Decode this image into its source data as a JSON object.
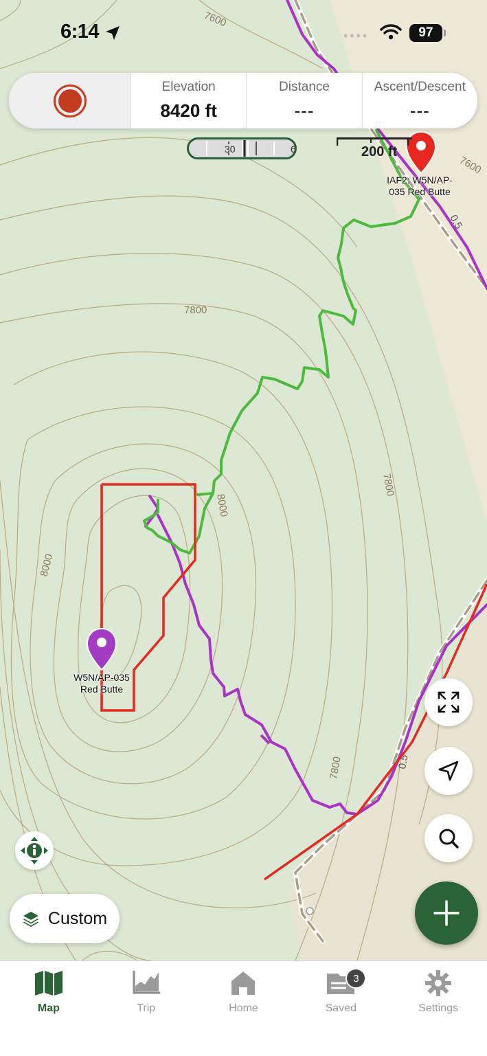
{
  "status_bar": {
    "time": "6:14",
    "battery": "97"
  },
  "stats": {
    "elevation": {
      "label": "Elevation",
      "value": "8420 ft"
    },
    "distance": {
      "label": "Distance",
      "value": "---"
    },
    "ascent_descent": {
      "label": "Ascent/Descent",
      "value": "---"
    }
  },
  "timeline": {
    "tick_left": "30",
    "tick_right": "6"
  },
  "scale_bar": {
    "label": "200 ft"
  },
  "map": {
    "contour_labels": [
      "7600",
      "7800",
      "8000",
      "8000",
      "7800",
      "7800",
      "7600"
    ],
    "trail_labels": [
      "0.5",
      "0.5"
    ],
    "markers": {
      "start": {
        "label": "IAF2: W5N/AP-035 Red Butte",
        "color": "#e8281e"
      },
      "summit": {
        "label": "W5N/AP-035 Red Butte",
        "color": "#a33cc3"
      }
    },
    "track_colors": {
      "green": "#4cba3c",
      "red": "#e8281e",
      "purple": "#a933c8"
    }
  },
  "controls": {
    "layer_button": "Custom"
  },
  "tabs": [
    {
      "label": "Map",
      "active": true
    },
    {
      "label": "Trip",
      "active": false
    },
    {
      "label": "Home",
      "active": false
    },
    {
      "label": "Saved",
      "active": false,
      "badge": "3"
    },
    {
      "label": "Settings",
      "active": false
    }
  ],
  "colors": {
    "accent": "#2a6336",
    "map_bg": "#dde8d4",
    "contour": "#b9a47e"
  }
}
